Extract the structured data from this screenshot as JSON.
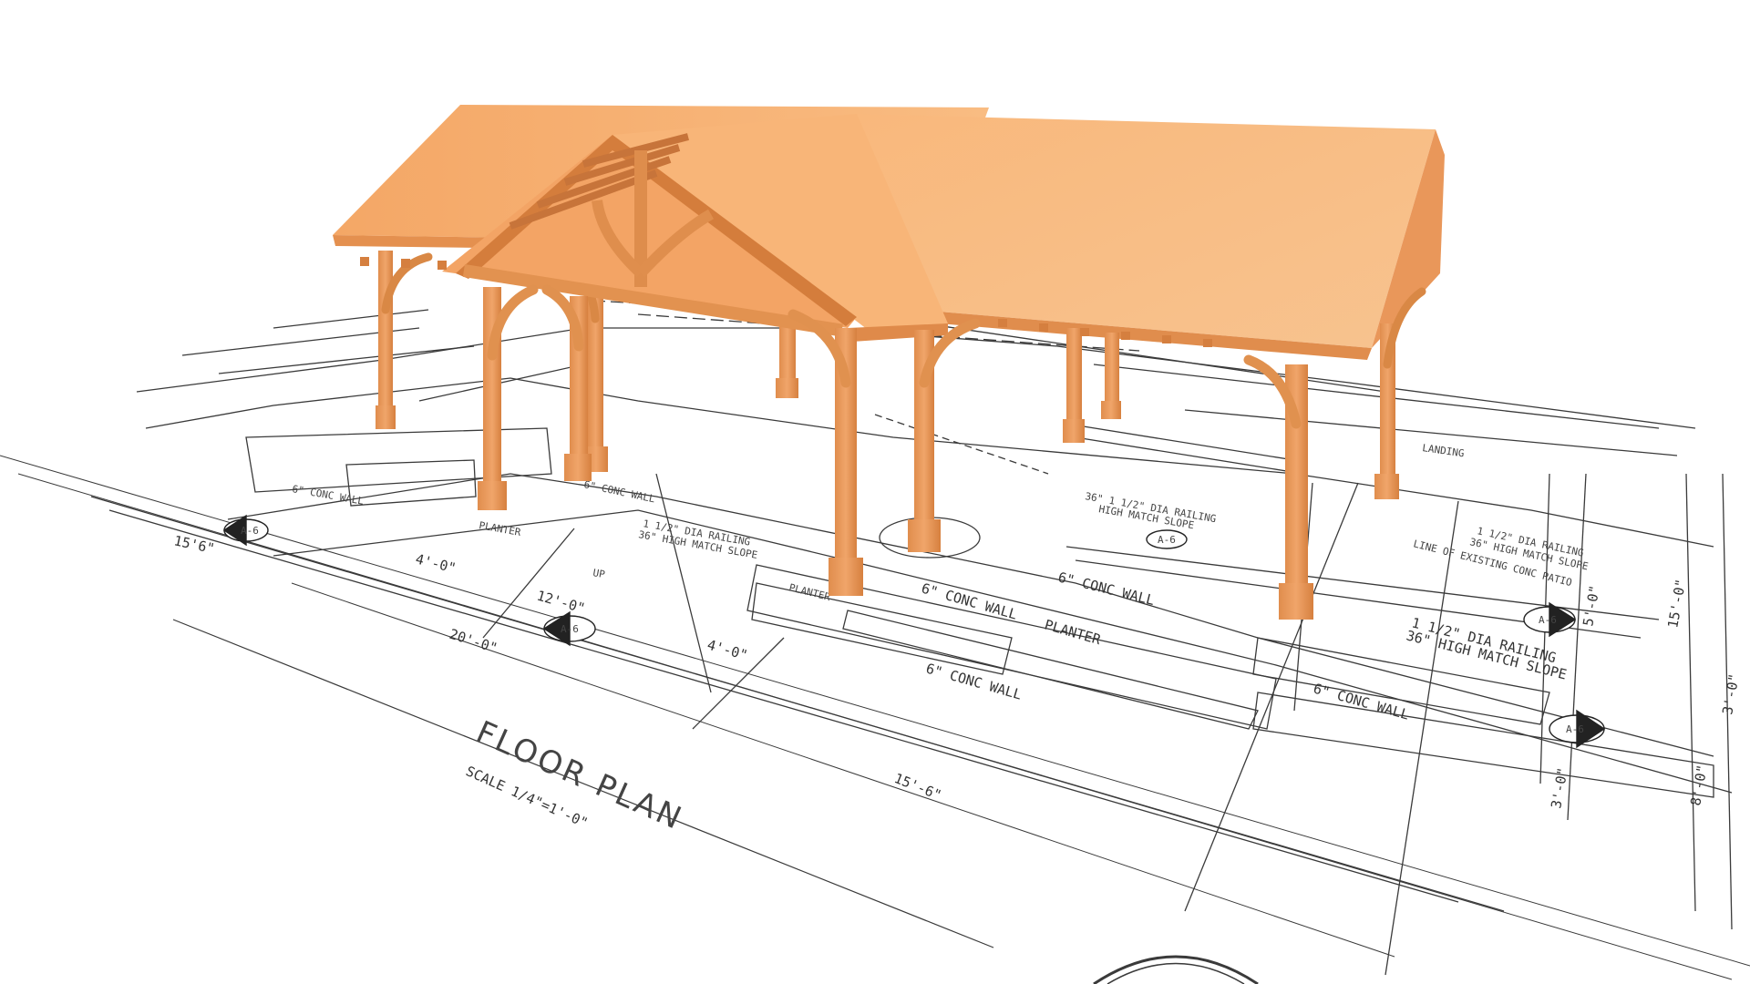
{
  "drawing": {
    "title": "FLOOR PLAN",
    "scale": "SCALE 1/4\"=1'-0\"",
    "section_marks": [
      "A-6",
      "A-6",
      "A-6",
      "A-6",
      "A-6"
    ],
    "dimensions": [
      "15'6\"",
      "4'-0\"",
      "12'-0\"",
      "20'-0\"",
      "4'-0\"",
      "15'-6\"",
      "15'-0\"",
      "5'-0\"",
      "3'-0\"",
      "8'-0\"",
      "3'-0\""
    ],
    "notes": {
      "railing_left": "1 1/2\" DIA RAILING",
      "railing_left_2": "36\" HIGH MATCH SLOPE",
      "railing_center": "36\" 1 1/2\" DIA RAILING",
      "railing_center_2": "HIGH MATCH SLOPE",
      "railing_right": "1 1/2\" DIA RAILING",
      "railing_right_2": "36\" HIGH MATCH SLOPE",
      "railing_top_right": "1 1/2\" DIA RAILING",
      "railing_top_right_2": "36\" HIGH MATCH SLOPE",
      "existing_patio": "LINE OF EXISTING CONC PATIO",
      "conc_wall_a": "6\" CONC WALL",
      "conc_wall_b": "6\" CONC WALL",
      "conc_wall_c": "6\" CONC WALL",
      "conc_wall_d": "6\" CONC WALL",
      "conc_wall_e": "6\" CONC WALL",
      "conc_wall_f": "6\" CONC WALL",
      "planter_a": "PLANTER",
      "planter_b": "PLANTER",
      "planter_c": "PLANTER",
      "landing": "LANDING",
      "up": "UP"
    }
  },
  "colors": {
    "timber": "#e89a5c",
    "timber_dark": "#c9773c",
    "roof": "#f8b77a",
    "roof_shade": "#eea466",
    "linework": "#3a3a3a"
  }
}
